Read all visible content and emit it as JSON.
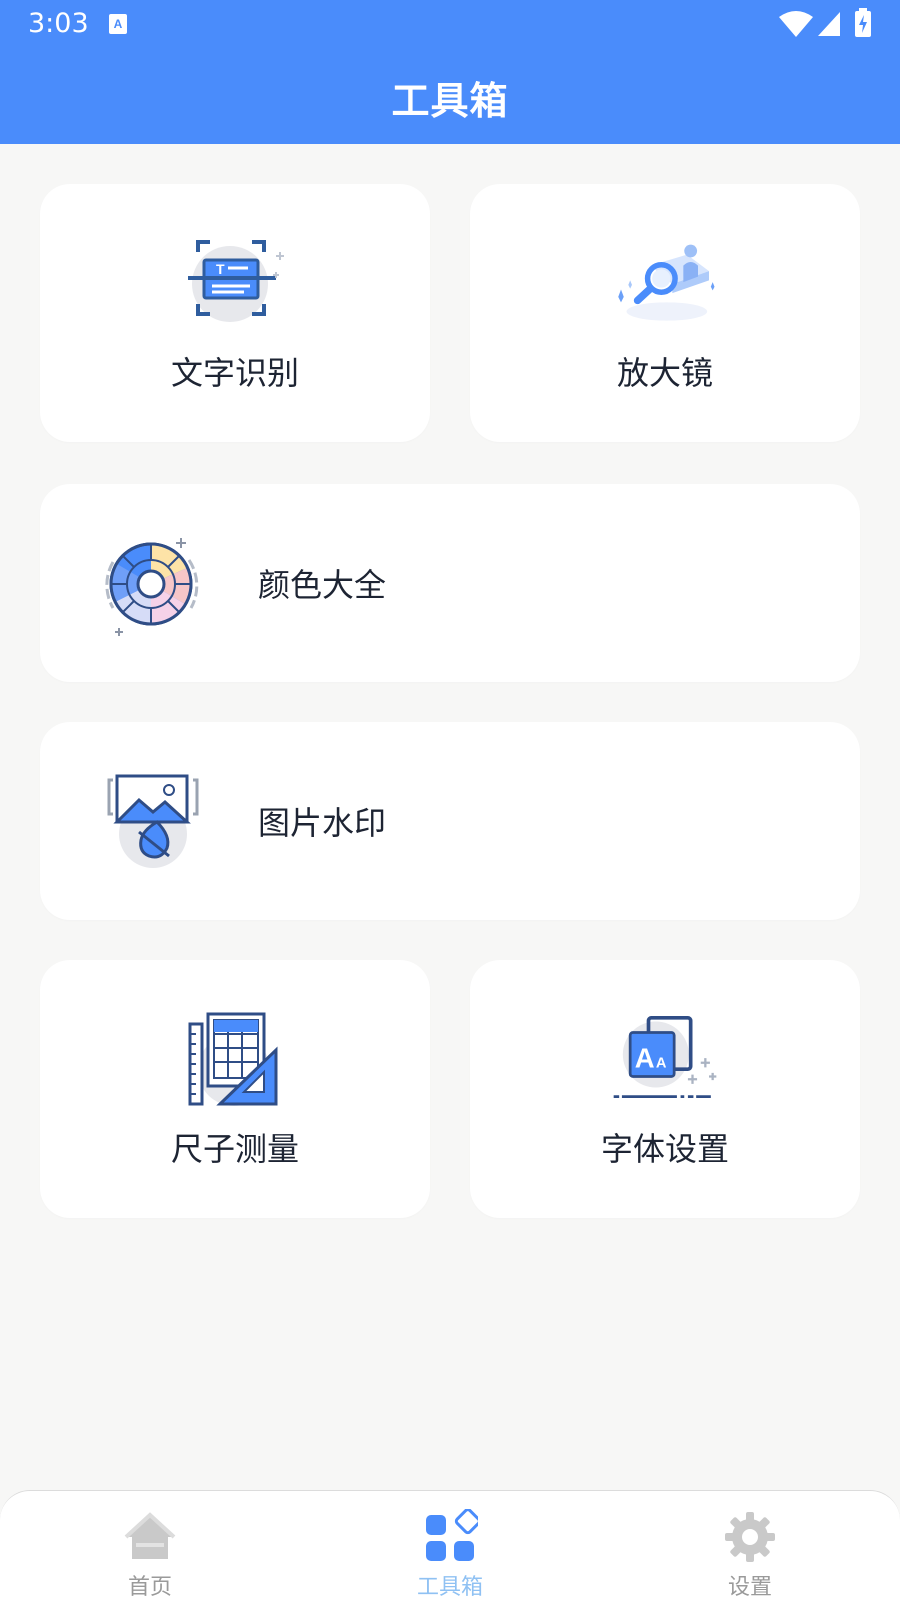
{
  "status_bar": {
    "time": "3:03"
  },
  "header": {
    "title": "工具箱"
  },
  "cards": {
    "ocr": {
      "label": "文字识别",
      "icon": "text-scan-icon"
    },
    "magnifier": {
      "label": "放大镜",
      "icon": "magnifier-icon"
    },
    "colors": {
      "label": "颜色大全",
      "icon": "color-wheel-icon"
    },
    "watermark": {
      "label": "图片水印",
      "icon": "image-watermark-icon"
    },
    "ruler": {
      "label": "尺子测量",
      "icon": "ruler-icon"
    },
    "font": {
      "label": "字体设置",
      "icon": "font-settings-icon"
    }
  },
  "bottom_nav": {
    "items": [
      {
        "label": "首页",
        "icon": "home-icon",
        "active": false
      },
      {
        "label": "工具箱",
        "icon": "toolbox-icon",
        "active": true
      },
      {
        "label": "设置",
        "icon": "gear-icon",
        "active": false
      }
    ]
  },
  "colors": {
    "header_bg": "#4a8cfb",
    "accent": "#4a8cfb",
    "nav_active": "#8fc1f3",
    "nav_inactive": "#9a9a9a"
  }
}
